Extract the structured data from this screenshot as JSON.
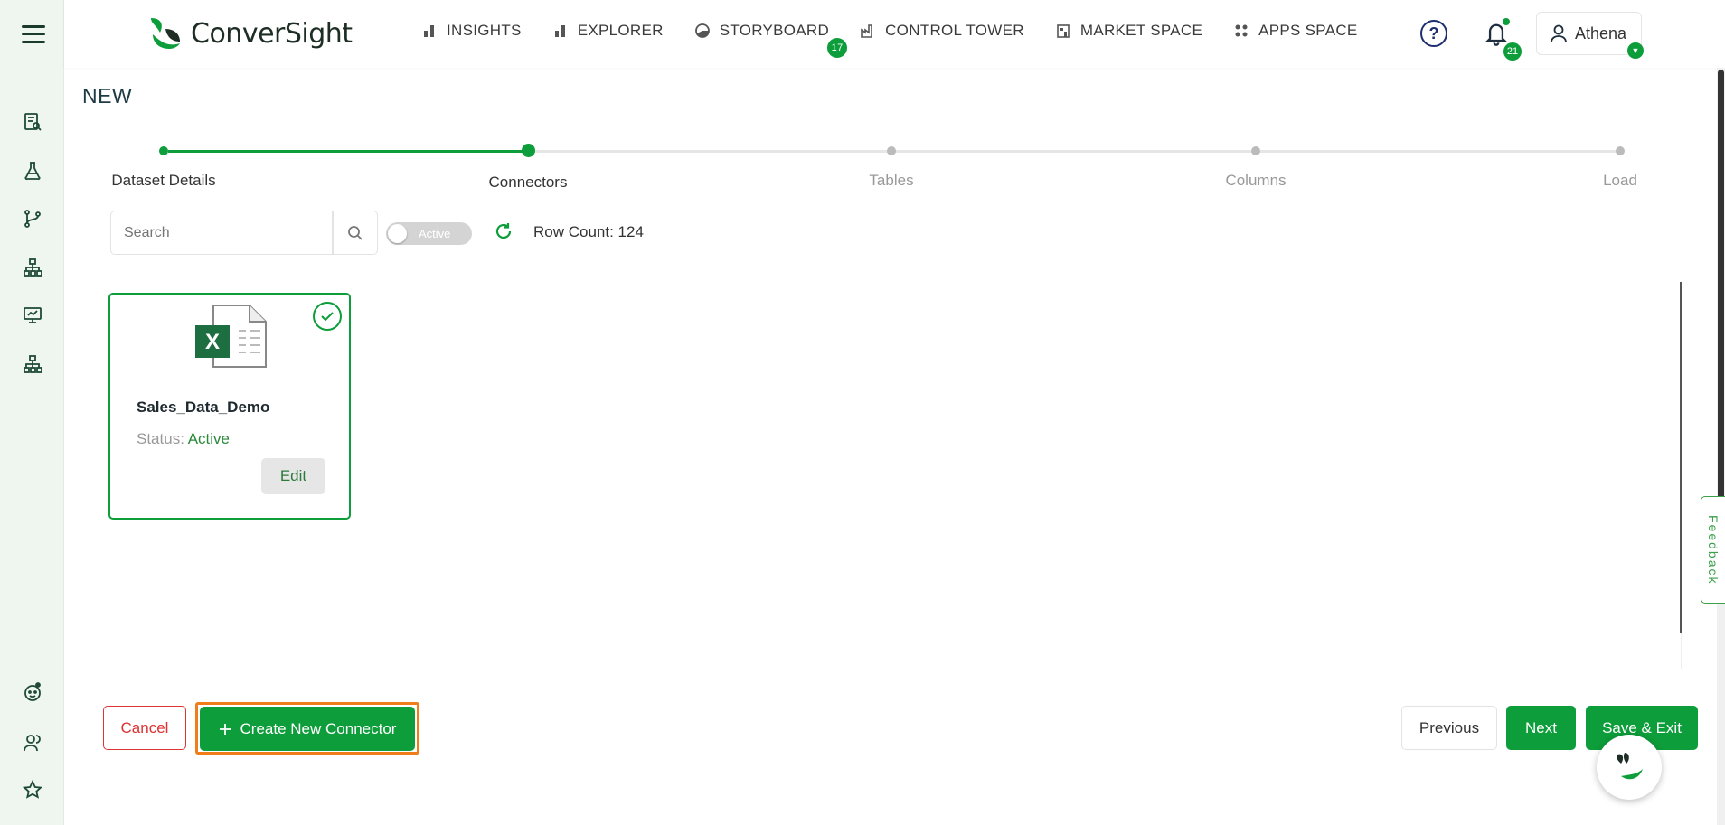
{
  "app": {
    "logo_text": "ConverSight",
    "brand_color": "#0d9d3a"
  },
  "nav": {
    "items": [
      {
        "label": "INSIGHTS",
        "icon": "bar-chart-icon"
      },
      {
        "label": "EXPLORER",
        "icon": "bar-chart-icon"
      },
      {
        "label": "STORYBOARD",
        "icon": "pie-icon",
        "badge": "17"
      },
      {
        "label": "CONTROL TOWER",
        "icon": "factory-icon"
      },
      {
        "label": "MARKET SPACE",
        "icon": "store-icon"
      },
      {
        "label": "APPS SPACE",
        "icon": "grid-dots-icon"
      }
    ],
    "notifications_badge": "21",
    "user_name": "Athena"
  },
  "page": {
    "title": "NEW"
  },
  "stepper": {
    "steps": [
      "Dataset Details",
      "Connectors",
      "Tables",
      "Columns",
      "Load"
    ],
    "current_index": 1
  },
  "toolbar": {
    "search_placeholder": "Search",
    "toggle_label": "Active",
    "row_count": "Row Count: 124"
  },
  "connector_card": {
    "name": "Sales_Data_Demo",
    "status_label": "Status:",
    "status_value": "Active",
    "edit_label": "Edit"
  },
  "feedback_label": "Feedback",
  "footer": {
    "cancel_label": "Cancel",
    "create_label": "Create New Connector",
    "previous_label": "Previous",
    "next_label": "Next",
    "save_exit_label": "Save & Exit"
  }
}
